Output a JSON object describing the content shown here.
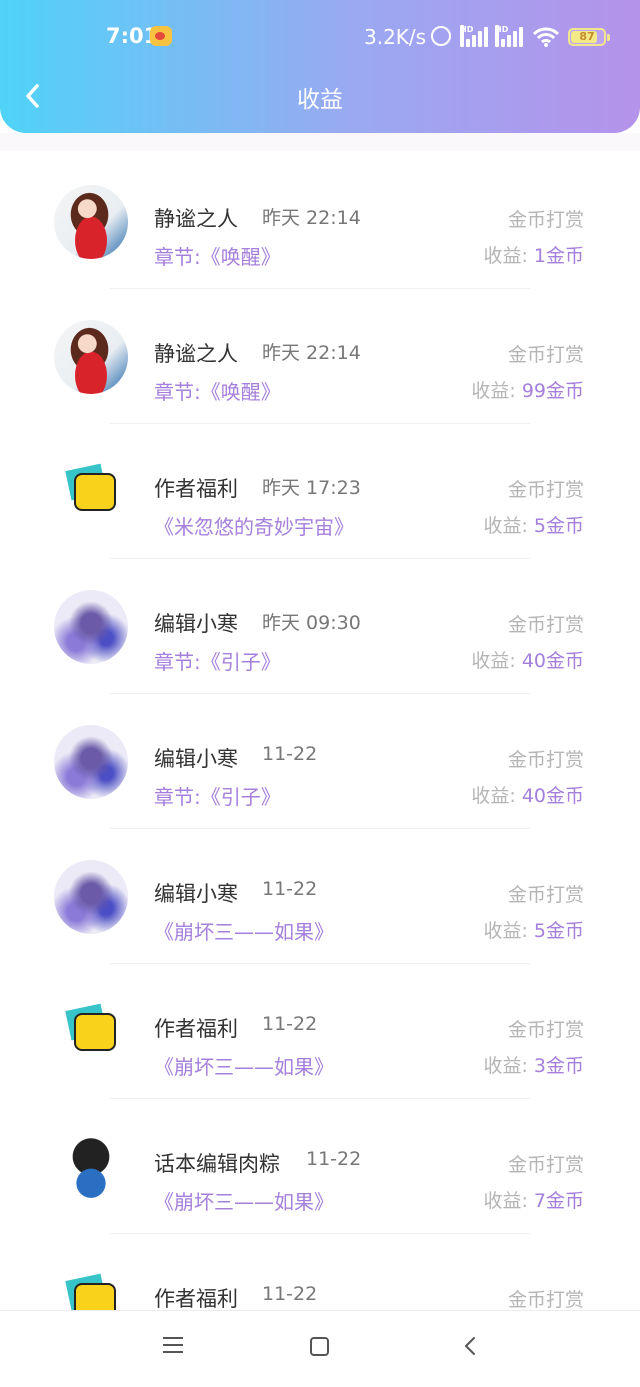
{
  "status_bar": {
    "time": "7:01",
    "speed": "3.2K/s",
    "hd1": "HD",
    "hd2": "HD",
    "battery": "87"
  },
  "header": {
    "title": "收益",
    "back_icon": "chevron-left-icon"
  },
  "records": [
    {
      "name": "静谧之人",
      "time": "昨天 22:14",
      "source": "金币打赏",
      "work": "章节:《唤醒》",
      "income_label": "收益: ",
      "amount": "1金币",
      "avatar": "girl"
    },
    {
      "name": "静谧之人",
      "time": "昨天 22:14",
      "source": "金币打赏",
      "work": "章节:《唤醒》",
      "income_label": "收益: ",
      "amount": "99金币",
      "avatar": "girl"
    },
    {
      "name": "作者福利",
      "time": "昨天 17:23",
      "source": "金币打赏",
      "work": "《米忽悠的奇妙宇宙》",
      "income_label": "收益: ",
      "amount": "5金币",
      "avatar": "chat"
    },
    {
      "name": "编辑小寒",
      "time": "昨天 09:30",
      "source": "金币打赏",
      "work": "章节:《引子》",
      "income_label": "收益: ",
      "amount": "40金币",
      "avatar": "anime"
    },
    {
      "name": "编辑小寒",
      "time": "11-22",
      "source": "金币打赏",
      "work": "章节:《引子》",
      "income_label": "收益: ",
      "amount": "40金币",
      "avatar": "anime"
    },
    {
      "name": "编辑小寒",
      "time": "11-22",
      "source": "金币打赏",
      "work": "《崩坏三——如果》",
      "income_label": "收益: ",
      "amount": "5金币",
      "avatar": "anime"
    },
    {
      "name": "作者福利",
      "time": "11-22",
      "source": "金币打赏",
      "work": "《崩坏三——如果》",
      "income_label": "收益: ",
      "amount": "3金币",
      "avatar": "chat"
    },
    {
      "name": "话本编辑肉粽",
      "time": "11-22",
      "source": "金币打赏",
      "work": "《崩坏三——如果》",
      "income_label": "收益: ",
      "amount": "7金币",
      "avatar": "skull"
    },
    {
      "name": "作者福利",
      "time": "11-22",
      "source": "金币打赏",
      "work": "",
      "income_label": "",
      "amount": "",
      "avatar": "chat"
    }
  ],
  "nav": {
    "menu_icon": "menu-icon",
    "home_icon": "home-square-icon",
    "back_icon": "back-triangle-icon"
  },
  "colors": {
    "header_gradient_start": "#4fd3f7",
    "header_gradient_end": "#b493ea",
    "accent_purple": "#a57fdc"
  }
}
